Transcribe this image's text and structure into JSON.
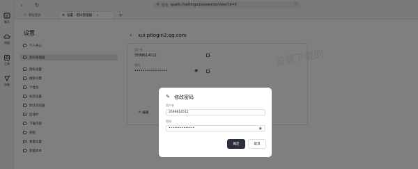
{
  "rail": {
    "items": [
      {
        "icon": "chat-icon",
        "label": "聊天"
      },
      {
        "icon": "cloud-icon",
        "label": "网盘"
      },
      {
        "icon": "tools-icon",
        "label": "工具"
      },
      {
        "icon": "skills-icon",
        "label": "技能"
      }
    ]
  },
  "toolbar": {
    "url_prefix": "夸克",
    "url": "quark://settings/passwords/view?id=0"
  },
  "tabs": [
    {
      "label": "新标签页",
      "active": false
    },
    {
      "label": "设置 - 密码管理器",
      "active": true
    }
  ],
  "settings": {
    "title": "设置",
    "items": [
      {
        "label": "个人中心",
        "active": false
      },
      {
        "label": "密码管理器",
        "active": true
      },
      {
        "label": "隐私设置",
        "active": false
      },
      {
        "label": "搜索引擎",
        "active": false
      },
      {
        "label": "个性化",
        "active": false
      },
      {
        "label": "标签设置",
        "active": false
      },
      {
        "label": "默认浏览器",
        "active": false
      },
      {
        "label": "启动时",
        "active": false
      },
      {
        "label": "下载内容",
        "active": false
      },
      {
        "label": "系统",
        "active": false
      },
      {
        "label": "重置设置",
        "active": false
      },
      {
        "label": "智能体本",
        "active": false
      }
    ]
  },
  "account": {
    "title": "xui.ptlogin2.qq.com",
    "username_label": "用户名",
    "username": "3599614512",
    "password_label": "密码",
    "password_masked": "••••••••••••••••",
    "edit_label": "编辑",
    "watermark": "设置下载的"
  },
  "dialog": {
    "title": "修改密码",
    "username_label": "用户名",
    "username": "3599614512",
    "password_label": "密码",
    "password_masked": "••••••••••••••",
    "confirm_label": "确定",
    "cancel_label": "取消"
  },
  "colors": {
    "overlay": "#00000080",
    "primary_button": "#2b2f3e"
  }
}
